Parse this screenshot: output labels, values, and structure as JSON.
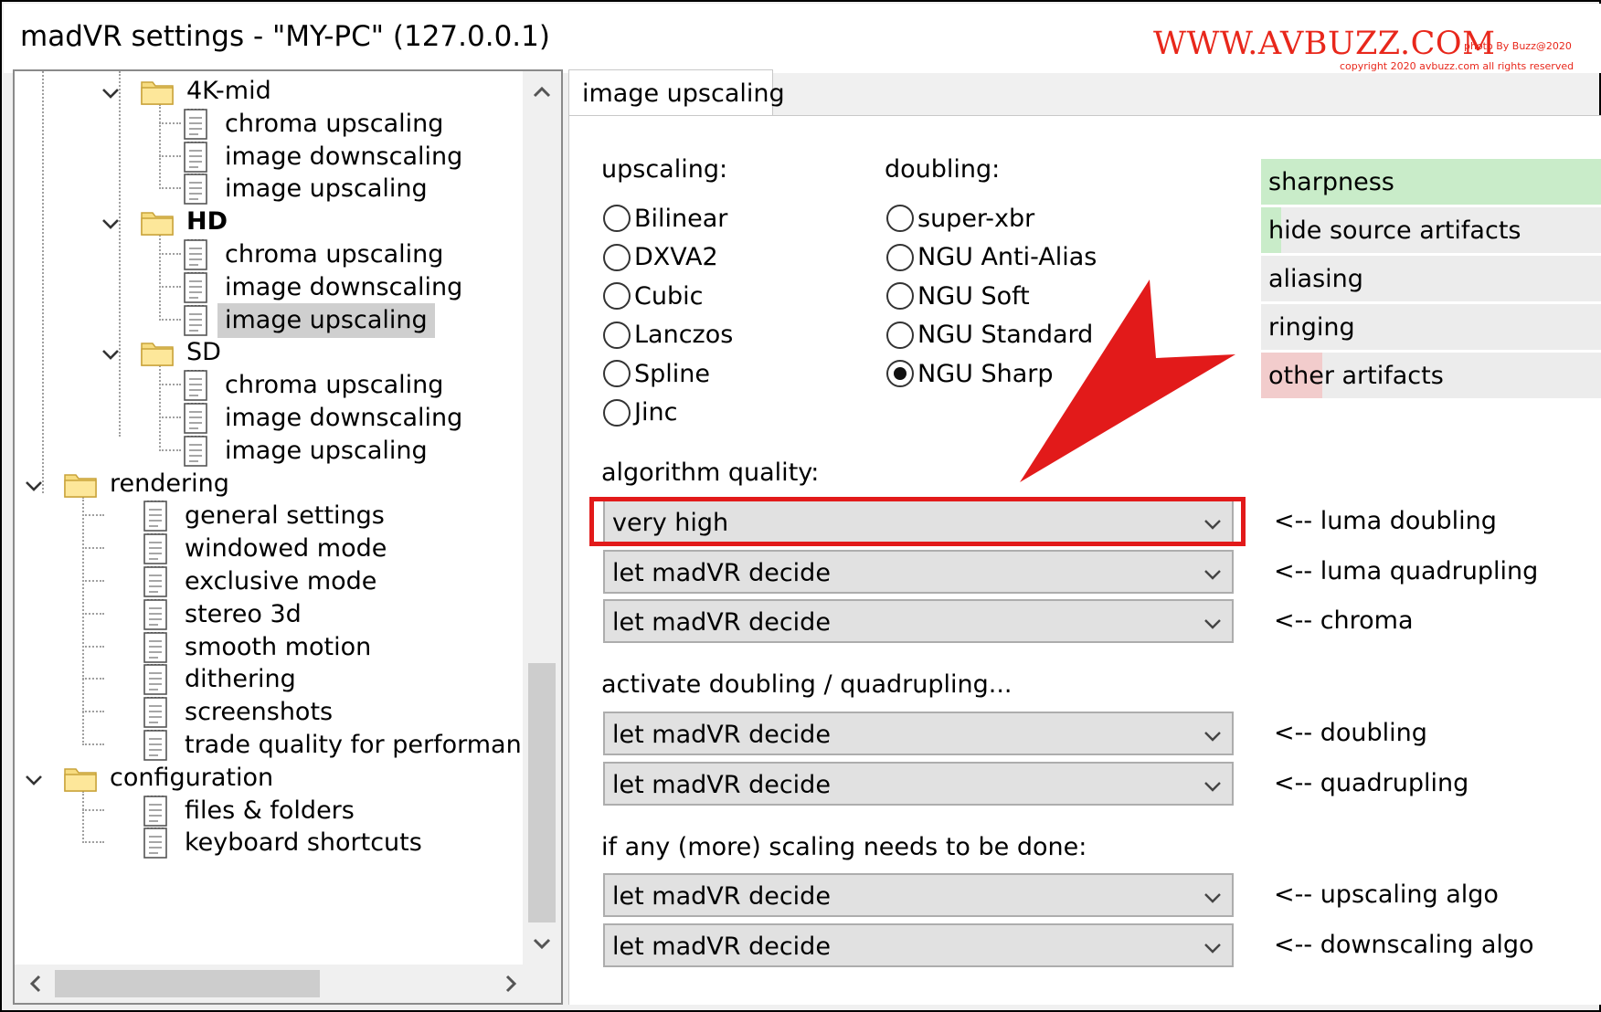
{
  "window": {
    "title": "madVR settings - \"MY-PC\" (127.0.0.1)",
    "watermark": "WWW.AVBUZZ.COM",
    "watermark_credit": "photo By Buzz@2020",
    "watermark_copyright": "copyright 2020 avbuzz.com all rights reserved"
  },
  "tree": {
    "items": [
      {
        "label": "4K-mid",
        "type": "folder",
        "level": 2
      },
      {
        "label": "chroma upscaling",
        "type": "doc",
        "level": 3
      },
      {
        "label": "image downscaling",
        "type": "doc",
        "level": 3
      },
      {
        "label": "image upscaling",
        "type": "doc",
        "level": 3
      },
      {
        "label": "HD",
        "type": "folder",
        "level": 2
      },
      {
        "label": "chroma upscaling",
        "type": "doc",
        "level": 3
      },
      {
        "label": "image downscaling",
        "type": "doc",
        "level": 3
      },
      {
        "label": "image upscaling",
        "type": "doc",
        "level": 3,
        "selected": true
      },
      {
        "label": "SD",
        "type": "folder",
        "level": 2
      },
      {
        "label": "chroma upscaling",
        "type": "doc",
        "level": 3
      },
      {
        "label": "image downscaling",
        "type": "doc",
        "level": 3
      },
      {
        "label": "image upscaling",
        "type": "doc",
        "level": 3
      },
      {
        "label": "rendering",
        "type": "folder",
        "level": 1
      },
      {
        "label": "general settings",
        "type": "doc",
        "level": 2
      },
      {
        "label": "windowed mode",
        "type": "doc",
        "level": 2
      },
      {
        "label": "exclusive mode",
        "type": "doc",
        "level": 2
      },
      {
        "label": "stereo 3d",
        "type": "doc",
        "level": 2
      },
      {
        "label": "smooth motion",
        "type": "doc",
        "level": 2
      },
      {
        "label": "dithering",
        "type": "doc",
        "level": 2
      },
      {
        "label": "screenshots",
        "type": "doc",
        "level": 2
      },
      {
        "label": "trade quality for performance",
        "type": "doc",
        "level": 2
      },
      {
        "label": "configuration",
        "type": "folder",
        "level": 1
      },
      {
        "label": "files & folders",
        "type": "doc",
        "level": 2
      },
      {
        "label": "keyboard shortcuts",
        "type": "doc",
        "level": 2
      }
    ]
  },
  "panel": {
    "tab_label": "image upscaling",
    "upscaling_label": "upscaling:",
    "doubling_label": "doubling:",
    "upscaling_options": [
      "Bilinear",
      "DXVA2",
      "Cubic",
      "Lanczos",
      "Spline",
      "Jinc"
    ],
    "doubling_options": [
      "super-xbr",
      "NGU Anti-Alias",
      "NGU Soft",
      "NGU Standard",
      "NGU Sharp"
    ],
    "doubling_selected": "NGU Sharp",
    "sharpness_list": [
      {
        "label": "sharpness",
        "fill_fraction": 1.0,
        "color": "#c9ecc9"
      },
      {
        "label": "hide source artifacts",
        "fill_fraction": 0.06,
        "color": "#c9ecc9"
      },
      {
        "label": "aliasing",
        "fill_fraction": 0,
        "color": "#c9ecc9"
      },
      {
        "label": "ringing",
        "fill_fraction": 0,
        "color": "#c9ecc9"
      },
      {
        "label": "other artifacts",
        "fill_fraction": 0.18,
        "color": "#f2cccc"
      }
    ],
    "algorithm_quality_label": "algorithm quality:",
    "algorithm_quality": [
      {
        "value": "very high",
        "hint": "<-- luma doubling"
      },
      {
        "value": "let madVR decide",
        "hint": "<-- luma quadrupling"
      },
      {
        "value": "let madVR decide",
        "hint": "<-- chroma"
      }
    ],
    "activate_label": "activate doubling / quadrupling...",
    "activate": [
      {
        "value": "let madVR decide",
        "hint": "<-- doubling"
      },
      {
        "value": "let madVR decide",
        "hint": "<-- quadrupling"
      }
    ],
    "scaling_label": "if any (more) scaling needs to be done:",
    "scaling": [
      {
        "value": "let madVR decide",
        "hint": "<-- upscaling algo"
      },
      {
        "value": "let madVR decide",
        "hint": "<-- downscaling algo"
      }
    ]
  },
  "colors": {
    "annotation_red": "#e21a1a",
    "watermark_red": "#e8271b",
    "sharpness_green": "#c9ecc9",
    "artifact_pink": "#f2cccc"
  }
}
